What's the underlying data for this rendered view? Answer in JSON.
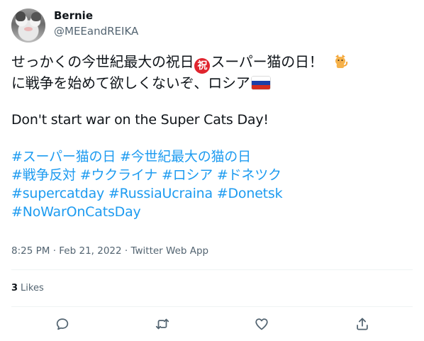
{
  "user": {
    "display_name": "Bernie",
    "handle": "@MEEandREIKA"
  },
  "tweet": {
    "line1_a": "せっかくの今世紀最大の祝日",
    "line1_emoji": "祝",
    "line1_b": "スーパー猫の日！",
    "line2": "に戦争を始めて欲しくないぞ、ロシア",
    "english": "Don't start war on the Super Cats Day!",
    "hashtag_lines": [
      "#スーパー猫の日 #今世紀最大の猫の日",
      "#戦争反対 #ウクライナ #ロシア #ドネツク",
      "#supercatday #RussiaUcraina #Donetsk",
      "#NoWarOnCatsDay"
    ]
  },
  "meta": {
    "time": "8:25 PM",
    "date": "Feb 21, 2022",
    "source": "Twitter Web App",
    "separator": " · "
  },
  "stats": {
    "likes_count": "3",
    "likes_label": "Likes"
  },
  "colors": {
    "link": "#1d9bf0",
    "secondary_text": "#536471",
    "primary_text": "#0f1419"
  },
  "icons": {
    "emoji_1": "congratulation-emoji",
    "emoji_2": "cat-emoji",
    "emoji_3": "russia-flag-emoji",
    "actions": [
      "reply-icon",
      "retweet-icon",
      "like-icon",
      "share-icon"
    ]
  }
}
